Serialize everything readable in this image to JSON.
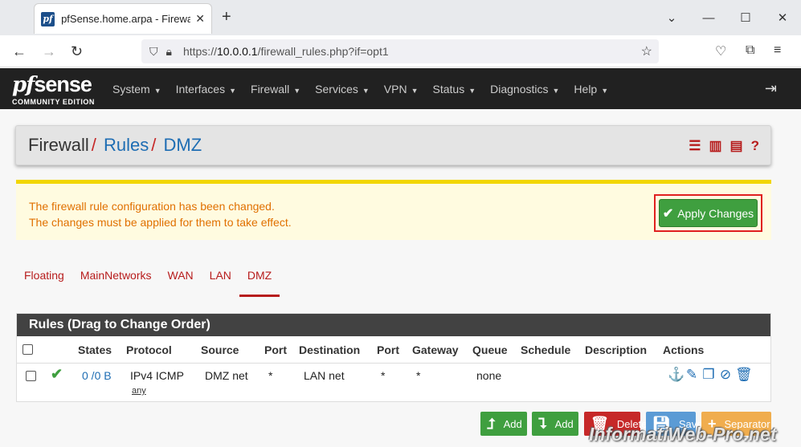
{
  "browser": {
    "tab_title": "pfSense.home.arpa - Firewall: R",
    "favicon_text": "pf",
    "url_prefix": "https://",
    "url_host": "10.0.0.1",
    "url_path": "/firewall_rules.php?if=opt1"
  },
  "pfsense": {
    "logo_pf": "pf",
    "logo_sense": "sense",
    "logo_sub": "COMMUNITY EDITION",
    "menu": [
      "System",
      "Interfaces",
      "Firewall",
      "Services",
      "VPN",
      "Status",
      "Diagnostics",
      "Help"
    ]
  },
  "breadcrumb": {
    "item1": "Firewall",
    "item2": "Rules",
    "item3": "DMZ",
    "sep": "/"
  },
  "alert": {
    "line1": "The firewall rule configuration has been changed.",
    "line2": "The changes must be applied for them to take effect.",
    "apply_label": "Apply Changes"
  },
  "tabs": [
    "Floating",
    "MainNetworks",
    "WAN",
    "LAN",
    "DMZ"
  ],
  "active_tab": "DMZ",
  "rules": {
    "title": "Rules (Drag to Change Order)",
    "columns": [
      "States",
      "Protocol",
      "Source",
      "Port",
      "Destination",
      "Port",
      "Gateway",
      "Queue",
      "Schedule",
      "Description",
      "Actions"
    ],
    "rows": [
      {
        "states": "0 /0 B",
        "protocol": "IPv4 ICMP",
        "protocol_sub": "any",
        "source": "DMZ net",
        "port": "*",
        "destination": "LAN net",
        "dest_port": "*",
        "gateway": "*",
        "queue": "none",
        "schedule": "",
        "description": ""
      }
    ]
  },
  "buttons": {
    "add_top": "Add",
    "add_bottom": "Add",
    "delete": "Delete",
    "save": "Save",
    "separator": "Separator"
  },
  "watermark": "InformatiWeb-Pro.net",
  "colors": {
    "accent_red": "#b71c1c",
    "link_blue": "#1e6db3",
    "success_green": "#3f9f3f",
    "alert_orange": "#e07000"
  }
}
